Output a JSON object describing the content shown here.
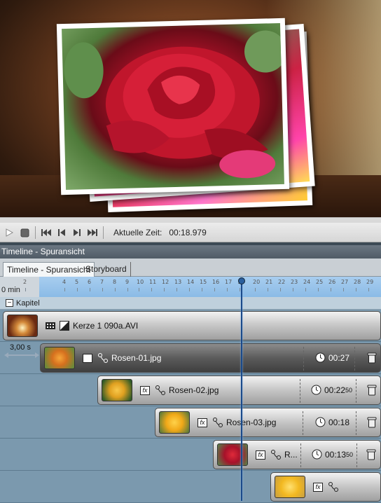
{
  "transport": {
    "current_time_label": "Aktuelle Zeit:",
    "current_time_value": "00:18.979"
  },
  "panel": {
    "title": "Timeline - Spuransicht"
  },
  "tabs": [
    {
      "label": "Timeline - Spuransicht",
      "active": true
    },
    {
      "label": "Storyboard",
      "active": false
    }
  ],
  "ruler": {
    "unit_label": "0 min",
    "ticks": [
      "2",
      "4",
      "5",
      "6",
      "7",
      "8",
      "9",
      "10",
      "11",
      "12",
      "13",
      "14",
      "15",
      "16",
      "17",
      "18",
      "20",
      "21",
      "22",
      "23",
      "24",
      "25",
      "26",
      "27",
      "28",
      "29"
    ]
  },
  "chapter": {
    "label": "Kapitel"
  },
  "gap": {
    "label": "3,00 s"
  },
  "clips": [
    {
      "name": "Kerze 1 090a.AVI",
      "type": "video",
      "duration": ""
    },
    {
      "name": "Rosen-01.jpg",
      "type": "image",
      "duration": "00:27",
      "duration_small": ""
    },
    {
      "name": "Rosen-02.jpg",
      "type": "image",
      "duration": "00:22",
      "duration_small": "50"
    },
    {
      "name": "Rosen-03.jpg",
      "type": "image",
      "duration": "00:18",
      "duration_small": ""
    },
    {
      "name": "R...",
      "type": "image",
      "duration": "00:13",
      "duration_small": "50"
    },
    {
      "name": "",
      "type": "image",
      "duration": "",
      "duration_small": ""
    }
  ],
  "colors": {
    "playhead": "#1a4a8a",
    "ruler_active": "#a8cdef",
    "track_bg": "#7b99ae"
  }
}
